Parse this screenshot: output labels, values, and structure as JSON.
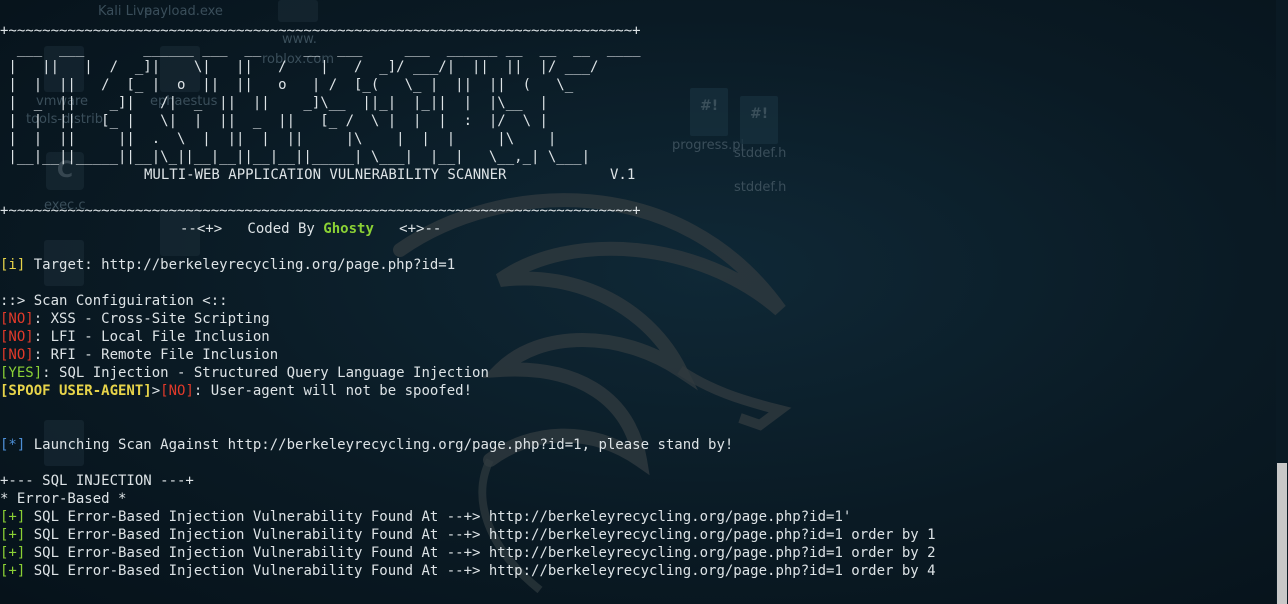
{
  "desktop": {
    "items": [
      "Kali Live",
      "payload.exe",
      "www.",
      "roblox.com",
      "vmware",
      "tools-distrib",
      "ephaestus",
      "exec.c",
      "progress.pl",
      "stddef.h",
      "stddef.h"
    ],
    "icon_letters": {
      "c_icon": "C",
      "script1": "#!",
      "script2": "#!"
    }
  },
  "banner": [
    "+~~~~~~~~~~~~~~~~~~~~~~~~~~~~~~~~~~~~~~~~~~~~~~~~~~~~~~~~~~~~~~~~~~~~~~~~~~+",
    "  ___  ___       ______ ___  __     __  ___     ___  ______ __  __  __  ____",
    " |   ||   |  /  _]|    \\|   ||   /    |   /  _]/ ___/|  ||  ||  |/ ___/",
    " |  |  ||   /  [_ |  o  ||  ||   o   | /  [_(   \\_ |  ||  ||  (   \\_",
    " |  _  ||    _]|   /|  _  ||  ||    _]\\__  ||_|  |_||  |  |\\__  |",
    " |  |  ||   [_ |   \\|  |  ||  _  ||   [_ /  \\ |  |  |  :  |/  \\ |",
    " |  |  ||     ||  .  \\  |  ||  |  ||     |\\    |  |  |     |\\    |",
    " |__|__||_____||__|\\_||__|__||__|__||_____| \\___|  |__|   \\__,_| \\___|"
  ],
  "subtitle": "MULTI-WEB APPLICATION VULNERABILITY SCANNER",
  "version": "V.1",
  "banner_border": "+~~~~~~~~~~~~~~~~~~~~~~~~~~~~~~~~~~~~~~~~~~~~~~~~~~~~~~~~~~~~~~~~~~~~~~~~~~+",
  "coded_by": {
    "left": "--<+>   Coded By ",
    "name": "Ghosty",
    "right": "   <+>--"
  },
  "target": {
    "tag": "[i]",
    "text": " Target: http://berkeleyrecycling.org/page.php?id=1"
  },
  "config_header": "::> Scan Configuiration <::",
  "config": [
    {
      "tag": "[NO]",
      "text": ": XSS - Cross-Site Scripting",
      "color": "#e23a2a"
    },
    {
      "tag": "[NO]",
      "text": ": LFI - Local File Inclusion",
      "color": "#e23a2a"
    },
    {
      "tag": "[NO]",
      "text": ": RFI - Remote File Inclusion",
      "color": "#e23a2a"
    },
    {
      "tag": "[YES]",
      "text": ": SQL Injection - Structured Query Language Injection",
      "color": "#8bd135"
    }
  ],
  "spoof": {
    "tag": "[SPOOF USER-AGENT]",
    "sep": ">",
    "no": "[NO]",
    "text": ": User-agent will not be spoofed!"
  },
  "launch": {
    "tag": "[*]",
    "text": " Launching Scan Against http://berkeleyrecycling.org/page.php?id=1, please stand by!"
  },
  "sqli_header": "+--- SQL INJECTION ---+",
  "error_based": "* Error-Based *",
  "results": [
    {
      "tag": "[+]",
      "text": " SQL Error-Based Injection Vulnerability Found At --+> http://berkeleyrecycling.org/page.php?id=1'"
    },
    {
      "tag": "[+]",
      "text": " SQL Error-Based Injection Vulnerability Found At --+> http://berkeleyrecycling.org/page.php?id=1 order by 1"
    },
    {
      "tag": "[+]",
      "text": " SQL Error-Based Injection Vulnerability Found At --+> http://berkeleyrecycling.org/page.php?id=1 order by 2"
    },
    {
      "tag": "[+]",
      "text": " SQL Error-Based Injection Vulnerability Found At --+> http://berkeleyrecycling.org/page.php?id=1 order by 4"
    }
  ]
}
